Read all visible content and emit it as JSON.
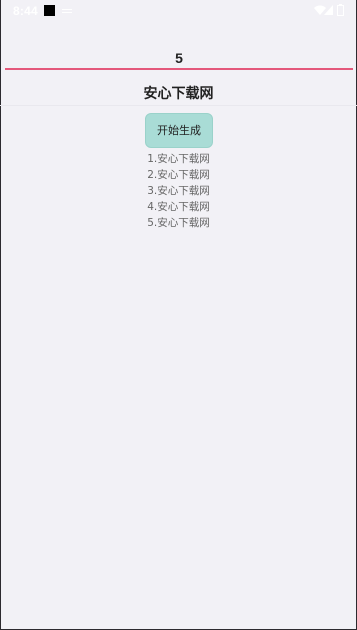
{
  "status_bar": {
    "time": "8:44"
  },
  "input": {
    "value": "5"
  },
  "header": {
    "title": "安心下载网"
  },
  "actions": {
    "generate_label": "开始生成"
  },
  "results": {
    "items": [
      "1.安心下载网",
      "2.安心下载网",
      "3.安心下载网",
      "4.安心下载网",
      "5.安心下载网"
    ]
  },
  "colors": {
    "accent_underline": "#e4587b",
    "button_fill": "#a9dcd6",
    "background": "#f2f1f6"
  }
}
